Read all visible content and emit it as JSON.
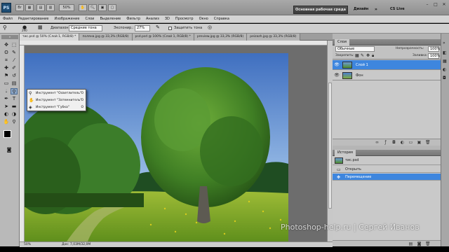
{
  "titlebar": {
    "logo": "PS",
    "zoom": "50%",
    "workspace_button": "Основная рабочая среда",
    "workspace_other": "Дизайн",
    "cslive": "CS Live"
  },
  "menu": [
    "Файл",
    "Редактирование",
    "Изображение",
    "Слои",
    "Выделение",
    "Фильтр",
    "Анализ",
    "3D",
    "Просмотр",
    "Окно",
    "Справка"
  ],
  "options": {
    "brush_size": "290",
    "range_label": "Диапазон:",
    "range_value": "Средние тона",
    "exposure_label": "Экспонир.:",
    "exposure_value": "27%",
    "protect_label": "Защитить тона"
  },
  "tabs": [
    "тис.psd @ 50% (Слой 1, RGB/8) *",
    "поляна.jpg @ 33,3% (RGB/8)",
    "psd.psd @ 100% (Слой 1, RGB/8) *",
    "preview.jpg @ 33,3% (RGB/8)",
    "peizazh.jpg @ 33,3% (RGB/8)"
  ],
  "flyout": {
    "items": [
      {
        "label": "Инструмент \"Осветлитель\"",
        "key": "O"
      },
      {
        "label": "Инструмент \"Затемнитель\"",
        "key": "O"
      },
      {
        "label": "Инструмент \"Губка\"",
        "key": "O"
      }
    ]
  },
  "status": {
    "zoom": "50%",
    "doc": "Док: 7,03M/32,0M"
  },
  "layers_panel": {
    "title": "Слои",
    "blend_mode": "Обычные",
    "opacity_label": "Непрозрачность:",
    "opacity_value": "100%",
    "lock_label": "Закрепить:",
    "fill_label": "Заливка:",
    "fill_value": "100%",
    "layers": [
      {
        "name": "Слой 1",
        "selected": true
      },
      {
        "name": "Фон",
        "selected": false
      }
    ]
  },
  "history_panel": {
    "title": "История",
    "snapshot": "тис.psd",
    "items": [
      {
        "name": "Открыть",
        "selected": false
      },
      {
        "name": "Перемещение",
        "selected": true
      }
    ]
  },
  "watermark": "Photoshop-help.ru | Сергей Иванов",
  "colors": {
    "selection_blue": "#3e86de",
    "chrome_gray": "#b9b9b9"
  }
}
